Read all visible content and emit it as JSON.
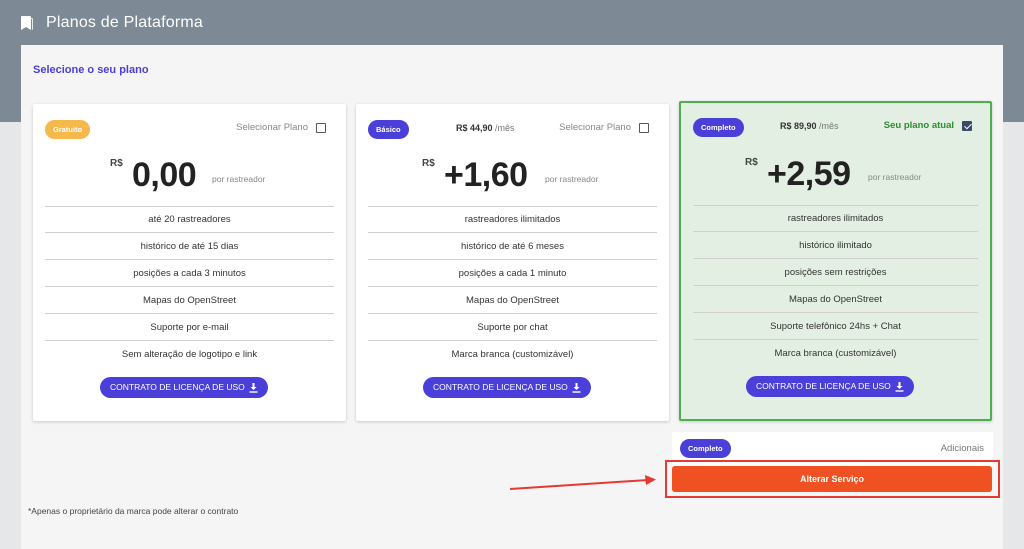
{
  "header": {
    "title": "Planos de Plataforma",
    "icon": "bookmark-icon"
  },
  "subtitle": "Selecione o seu plano",
  "plans": [
    {
      "badge": "Gratuito",
      "badge_color": "#f5b84a",
      "select_label": "Selecionar Plano",
      "currency": "R$",
      "amount": "0,00",
      "unit": "por rastreador",
      "features": [
        "até 20 rastreadores",
        "histórico de até 15 dias",
        "posições a cada 3 minutos",
        "Mapas do OpenStreet",
        "Suporte por e-mail",
        "Sem alteração de logotipo e link"
      ],
      "license_button": "CONTRATO DE LICENÇA DE USO"
    },
    {
      "badge": "Básico",
      "badge_color": "#4a3fd8",
      "monthly_price": "R$ 44,90",
      "monthly_suffix": "/mês",
      "select_label": "Selecionar Plano",
      "currency": "R$",
      "amount": "+1,60",
      "unit": "por rastreador",
      "features": [
        "rastreadores ilimitados",
        "histórico de até 6 meses",
        "posições a cada 1 minuto",
        "Mapas do OpenStreet",
        "Suporte por chat",
        "Marca branca (customizável)"
      ],
      "license_button": "CONTRATO DE LICENÇA DE USO"
    },
    {
      "badge": "Completo",
      "badge_color": "#4a3fd8",
      "monthly_price": "R$ 89,90",
      "monthly_suffix": "/mês",
      "current_label": "Seu plano atual",
      "currency": "R$",
      "amount": "+2,59",
      "unit": "por rastreador",
      "features": [
        "rastreadores ilimitados",
        "histórico ilimitado",
        "posições sem restrições",
        "Mapas do OpenStreet",
        "Suporte telefônico 24hs + Chat",
        "Marca branca (customizável)"
      ],
      "license_button": "CONTRATO DE LICENÇA DE USO"
    }
  ],
  "addons": {
    "badge": "Completo",
    "label": "Adicionais"
  },
  "alter_button": "Alterar Serviço",
  "footnote": "*Apenas o proprietário da marca pode alterar o contrato",
  "colors": {
    "accent": "#4a3fd8",
    "alter": "#f05122",
    "current_plan_green": "#4caf50",
    "highlight_red": "#e53935"
  }
}
